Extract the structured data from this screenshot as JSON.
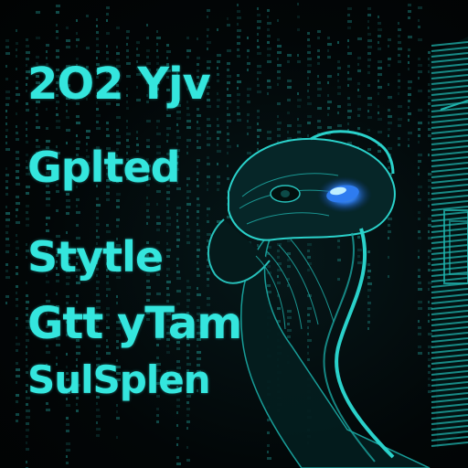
{
  "colors": {
    "background": "#020607",
    "accent": "#34e6de",
    "glow_blue": "#2e7cf0"
  },
  "headline_lines": [
    "2O2 Yjv",
    "Gplted",
    "Stytle",
    "Gtt yTam",
    "SulSplen"
  ]
}
